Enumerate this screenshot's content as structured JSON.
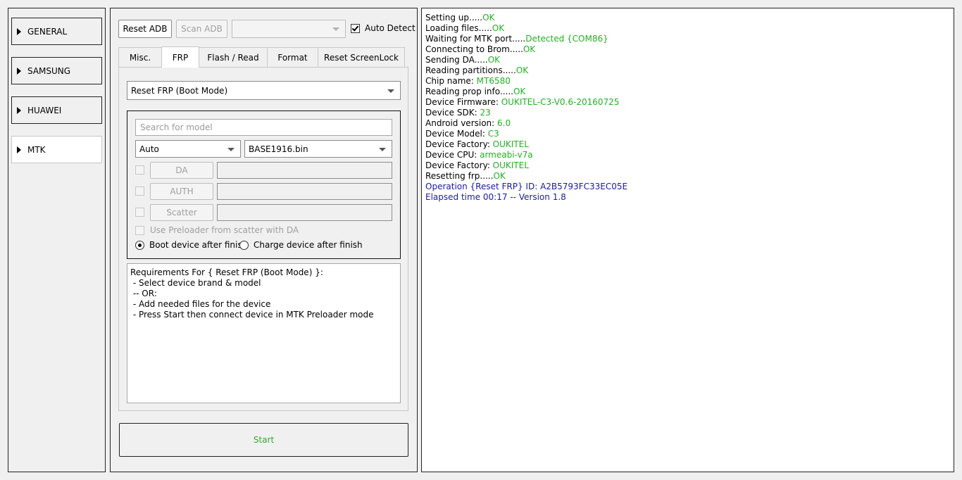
{
  "sidebar": {
    "items": [
      {
        "label": "GENERAL",
        "active": false
      },
      {
        "label": "SAMSUNG",
        "active": false
      },
      {
        "label": "HUAWEI",
        "active": false
      },
      {
        "label": "MTK",
        "active": true
      }
    ]
  },
  "toolbar": {
    "reset_adb_label": "Reset ADB",
    "scan_adb_label": "Scan ADB",
    "device_combo_value": "",
    "auto_detect_label": "Auto Detect",
    "auto_detect_checked": true
  },
  "tabs": [
    {
      "label": "Misc.",
      "active": false
    },
    {
      "label": "FRP",
      "active": true
    },
    {
      "label": "Flash / Read",
      "active": false
    },
    {
      "label": "Format",
      "active": false
    },
    {
      "label": "Reset ScreenLock",
      "active": false
    }
  ],
  "frp": {
    "operation_select": "Reset FRP (Boot Mode)",
    "search_placeholder": "Search for model",
    "mode_select": "Auto",
    "file_select": "BASE1916.bin",
    "da_label": "DA",
    "auth_label": "AUTH",
    "scatter_label": "Scatter",
    "da_path": "",
    "auth_path": "",
    "scatter_path": "",
    "use_preloader_label": "Use Preloader from scatter with DA",
    "boot_after_label": "Boot device after finish",
    "charge_after_label": "Charge device after finish",
    "boot_after_selected": true
  },
  "requirements": {
    "lines": [
      "Requirements For { Reset FRP (Boot Mode) }:",
      " - Select device brand & model",
      " -- OR:",
      " - Add needed files for the device",
      " - Press Start then connect device in MTK Preloader mode"
    ]
  },
  "start_label": "Start",
  "colors": {
    "ok_green": "#22b022",
    "info_blue": "#1a1aa8",
    "start_green": "#2eab2e"
  },
  "log": [
    {
      "text": "Setting up.....",
      "value": "OK",
      "type": "ok"
    },
    {
      "text": "Loading files.....",
      "value": "OK",
      "type": "ok"
    },
    {
      "text": "Waiting for MTK port.....",
      "value": "Detected {COM86}",
      "type": "ok"
    },
    {
      "text": "Connecting to Brom.....",
      "value": "OK",
      "type": "ok"
    },
    {
      "text": "Sending DA.....",
      "value": "OK",
      "type": "ok"
    },
    {
      "text": "Reading partitions.....",
      "value": "OK",
      "type": "ok"
    },
    {
      "text": "Chip name: ",
      "value": "MT6580",
      "type": "ok"
    },
    {
      "text": "Reading prop info.....",
      "value": "OK",
      "type": "ok"
    },
    {
      "text": "Device Firmware: ",
      "value": "OUKITEL-C3-V0.6-20160725",
      "type": "ok"
    },
    {
      "text": "Device SDK: ",
      "value": "23",
      "type": "ok"
    },
    {
      "text": "Android version: ",
      "value": "6.0",
      "type": "ok"
    },
    {
      "text": "Device Model: ",
      "value": "C3",
      "type": "ok"
    },
    {
      "text": "Device Factory: ",
      "value": "OUKITEL",
      "type": "ok"
    },
    {
      "text": "Device CPU: ",
      "value": "armeabi-v7a",
      "type": "ok"
    },
    {
      "text": "Device Factory: ",
      "value": "OUKITEL",
      "type": "ok"
    },
    {
      "text": "Resetting frp.....",
      "value": "OK",
      "type": "ok"
    },
    {
      "text": "Operation {Reset FRP} ID: A2B5793FC33EC05E",
      "value": "",
      "type": "blue"
    },
    {
      "text": "Elapsed time 00:17 -- Version 1.8",
      "value": "",
      "type": "blue"
    }
  ]
}
